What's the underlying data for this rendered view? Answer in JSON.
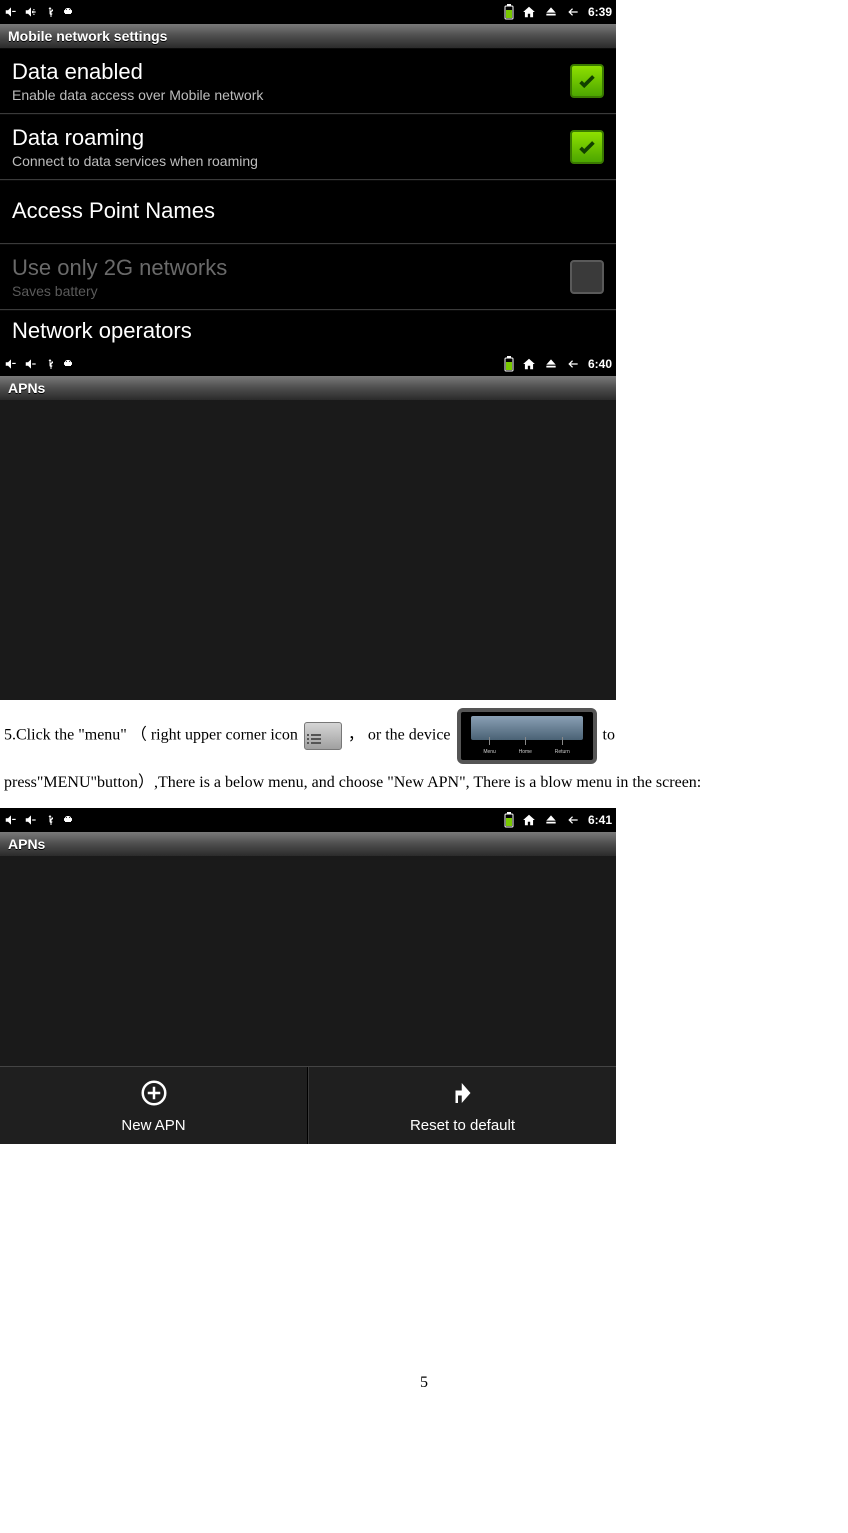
{
  "shot1": {
    "time": "6:39",
    "titlebar": "Mobile network settings",
    "rows": {
      "data_enabled": {
        "title": "Data enabled",
        "subtitle": "Enable data access over Mobile network"
      },
      "data_roaming": {
        "title": "Data roaming",
        "subtitle": "Connect to data services when roaming"
      },
      "apn": {
        "title": "Access Point Names"
      },
      "only2g": {
        "title": "Use only 2G networks",
        "subtitle": "Saves battery"
      },
      "operators": {
        "title": "Network operators"
      }
    }
  },
  "shot2": {
    "time": "6:40",
    "titlebar": "APNs"
  },
  "instruction": {
    "part1": "5.Click the \"menu\"  （ right upper corner icon",
    "part2": "，   or the device",
    "device_buttons": [
      "Menu",
      "Home",
      "Return"
    ],
    "part3": "   to",
    "part4": "press\"MENU\"button）,There is a below menu, and choose \"New APN\", There is a blow menu in the screen:"
  },
  "shot3": {
    "time": "6:41",
    "titlebar": "APNs",
    "menu": {
      "new_apn": "New APN",
      "reset": "Reset to default"
    }
  },
  "page_number": "5"
}
